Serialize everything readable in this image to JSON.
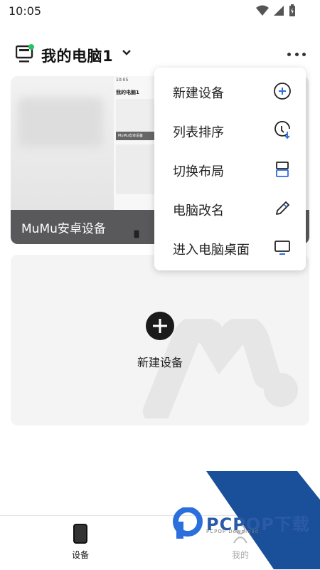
{
  "status": {
    "time": "10:05"
  },
  "header": {
    "title": "我的电脑1"
  },
  "device": {
    "name": "MuMu安卓设备",
    "preview_time": "10:05",
    "preview_title": "我的电脑1",
    "preview_card_label": "MuMu安卓设备"
  },
  "new_device": {
    "label": "新建设备"
  },
  "menu": {
    "items": [
      {
        "label": "新建设备",
        "icon": "add-circle-icon"
      },
      {
        "label": "列表排序",
        "icon": "sort-clock-icon"
      },
      {
        "label": "切换布局",
        "icon": "layout-icon"
      },
      {
        "label": "电脑改名",
        "icon": "pencil-icon"
      },
      {
        "label": "进入电脑桌面",
        "icon": "monitor-icon"
      }
    ]
  },
  "nav": {
    "devices": "设备",
    "me": "我的"
  },
  "watermark": {
    "brand": "PCPOP下载",
    "sub": "PCPOP Download"
  },
  "colors": {
    "accent": "#2a6fdb",
    "online": "#22c55e",
    "card_label_bg": "#59595c"
  }
}
